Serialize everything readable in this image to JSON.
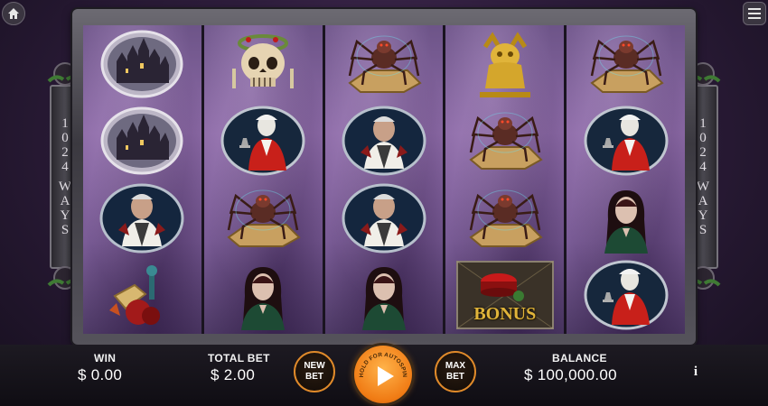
{
  "top_controls": {
    "home_icon": "home-icon",
    "menu_icon": "menu-icon"
  },
  "side_banner": {
    "lines": [
      "1",
      "0",
      "2",
      "4",
      "W",
      "A",
      "Y",
      "S"
    ]
  },
  "reels": [
    [
      "haunted-castle",
      "haunted-castle",
      "zombie-butler",
      "potion-bottle"
    ],
    [
      "skull-with-crown",
      "vampire-gentleman",
      "spider",
      "dark-haired-woman"
    ],
    [
      "spider",
      "zombie-butler",
      "zombie-butler",
      "dark-haired-woman"
    ],
    [
      "golden-gargoyle",
      "spider",
      "spider",
      "bonus"
    ],
    [
      "spider",
      "vampire-gentleman",
      "dark-haired-woman",
      "vampire-gentleman"
    ]
  ],
  "bonus_text": "BONUS",
  "bottom_bar": {
    "win_label": "WIN",
    "win_currency": "$",
    "win_value": "0.00",
    "total_bet_label": "TOTAL BET",
    "total_bet_currency": "$",
    "total_bet_value": "2.00",
    "new_bet_line1": "NEW",
    "new_bet_line2": "BET",
    "spin_hint": "HOLD FOR AUTOSPIN",
    "max_bet_line1": "MAX",
    "max_bet_line2": "BET",
    "balance_label": "BALANCE",
    "balance_currency": "$",
    "balance_value": "100,000.00",
    "info_icon": "i"
  },
  "colors": {
    "accent": "#f07b14",
    "button_border": "#e08a2a",
    "bonus_gold": "#e0b43a"
  }
}
